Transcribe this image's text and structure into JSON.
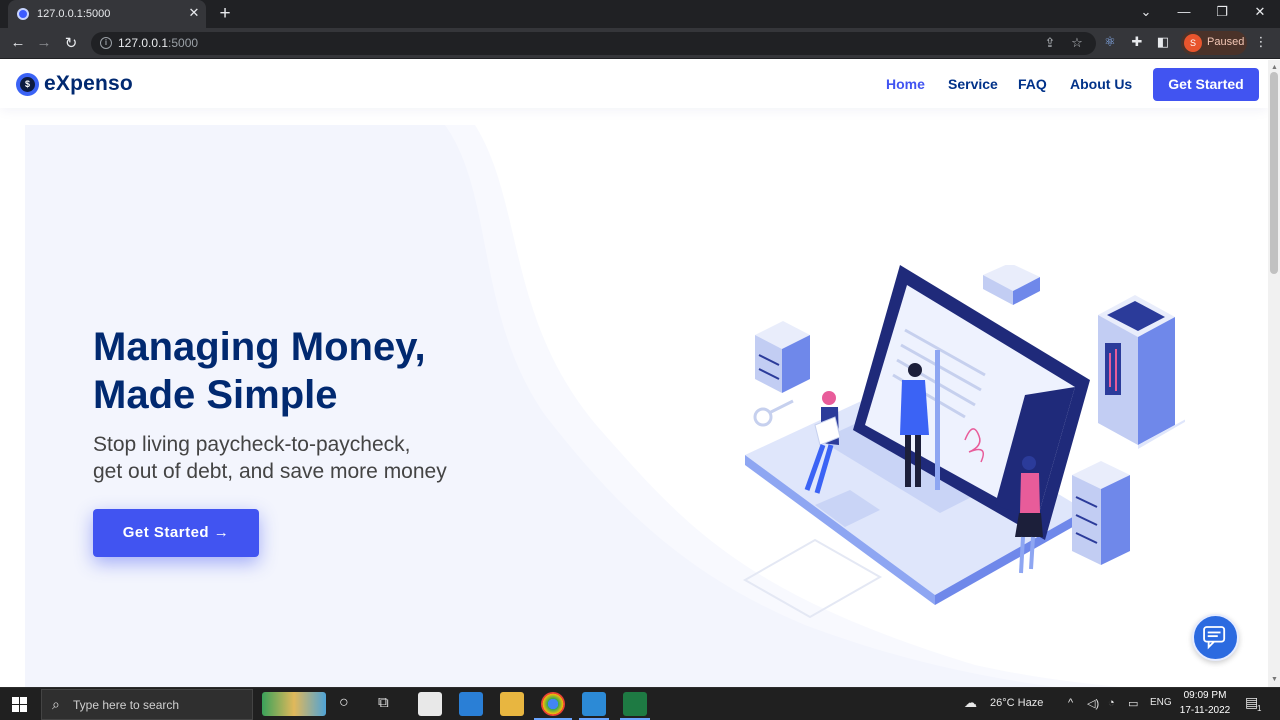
{
  "browser": {
    "tab_title": "127.0.0.1:5000",
    "url_host": "127.0.0.1",
    "url_port": ":5000",
    "profile_initial": "S",
    "profile_status": "Paused"
  },
  "site": {
    "logo_initial": "$",
    "logo_text": "eXpenso",
    "nav": [
      {
        "label": "Home",
        "active": true
      },
      {
        "label": "Service",
        "active": false
      },
      {
        "label": "FAQ",
        "active": false
      },
      {
        "label": "About Us",
        "active": false
      }
    ],
    "nav_cta": "Get Started",
    "hero": {
      "title_line1": "Managing Money,",
      "title_line2": "Made Simple",
      "subtitle_line1": "Stop living paycheck-to-paycheck,",
      "subtitle_line2": "get out of debt, and save more money",
      "cta": "Get Started →"
    },
    "chat_icon": "chat-bubble-icon"
  },
  "taskbar": {
    "search_placeholder": "Type here to search",
    "weather": "26°C  Haze",
    "language": "ENG",
    "time": "09:09 PM",
    "date": "17-11-2022",
    "notification_count": "1"
  },
  "colors": {
    "brand": "#4154f1",
    "heading": "#012970",
    "hero_bg": "#f3f5fd"
  }
}
